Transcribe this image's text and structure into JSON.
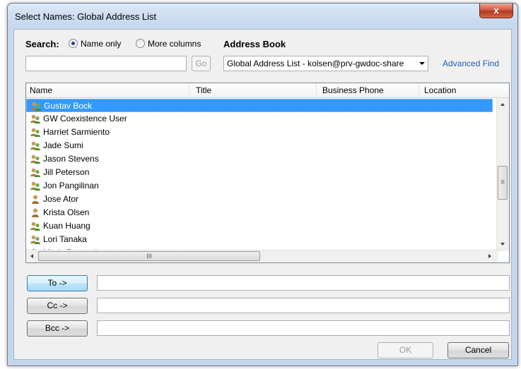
{
  "window": {
    "title": "Select Names: Global Address List",
    "close_glyph": "x"
  },
  "search": {
    "label": "Search:",
    "options": [
      {
        "label": "Name only",
        "selected": true
      },
      {
        "label": "More columns",
        "selected": false
      }
    ],
    "input_value": "",
    "go_label": "Go"
  },
  "address_book": {
    "label": "Address Book",
    "selected": "Global Address List - kolsen@prv-gwdoc-share",
    "advanced_find": "Advanced Find"
  },
  "list": {
    "columns": [
      "Name",
      "Title",
      "Business Phone",
      "Location"
    ],
    "rows": [
      {
        "name": "Gustav Bock",
        "icon": "group-contact-icon",
        "selected": true
      },
      {
        "name": "GW Coexistence User",
        "icon": "group-contact-icon"
      },
      {
        "name": "Harriet Sarmiento",
        "icon": "group-contact-icon"
      },
      {
        "name": "Jade Sumi",
        "icon": "group-contact-icon"
      },
      {
        "name": "Jason Stevens",
        "icon": "group-contact-icon"
      },
      {
        "name": "Jill Peterson",
        "icon": "group-contact-icon"
      },
      {
        "name": "Jon Pangilinan",
        "icon": "group-contact-icon"
      },
      {
        "name": "Jose Ator",
        "icon": "single-contact-icon"
      },
      {
        "name": "Krista Olsen",
        "icon": "single-contact-icon"
      },
      {
        "name": "Kuan Huang",
        "icon": "group-contact-icon"
      },
      {
        "name": "Lori Tanaka",
        "icon": "group-contact-icon"
      },
      {
        "name": "Marie Peypoch",
        "icon": "group-contact-icon"
      }
    ],
    "hscroll_grip": "III",
    "vscroll_grip": "≡"
  },
  "recipients": {
    "to_label": "To ->",
    "cc_label": "Cc ->",
    "bcc_label": "Bcc ->",
    "to_value": "",
    "cc_value": "",
    "bcc_value": ""
  },
  "footer": {
    "ok_label": "OK",
    "cancel_label": "Cancel"
  },
  "colors": {
    "selection": "#3399ff",
    "link": "#1f5fb5",
    "close": "#c8533a"
  }
}
